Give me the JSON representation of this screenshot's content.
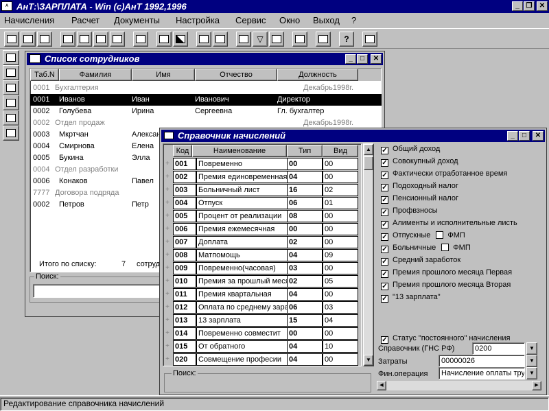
{
  "app_title": "АнТ:\\ЗАРПЛАТА - Win (c)АнТ 1992,1996",
  "menu": [
    "Начисления",
    "Расчет",
    "Документы",
    "Настройка",
    "Сервис",
    "Окно",
    "Выход",
    "?"
  ],
  "emp_window": {
    "title": "Список сотрудников",
    "columns": [
      "Таб.N",
      "Фамилия",
      "Имя",
      "Отчество",
      "Должность"
    ],
    "rows": [
      {
        "tab": "0001",
        "fam": "Бухгалтерия",
        "name": "",
        "otch": "",
        "dol": "Декабрь1998г.",
        "type": "group"
      },
      {
        "tab": "0001",
        "fam": "Иванов",
        "name": "Иван",
        "otch": "Иванович",
        "dol": "Директор",
        "type": "selected"
      },
      {
        "tab": "0002",
        "fam": "Голубева",
        "name": "Ирина",
        "otch": "Сергеевна",
        "dol": "Гл. бухгалтер",
        "type": "normal"
      },
      {
        "tab": "0002",
        "fam": "Отдел продаж",
        "name": "",
        "otch": "",
        "dol": "Декабрь1998г.",
        "type": "group"
      },
      {
        "tab": "0003",
        "fam": "Мкртчан",
        "name": "Алексан",
        "otch": "",
        "dol": "",
        "type": "normal"
      },
      {
        "tab": "0004",
        "fam": "Смирнова",
        "name": "Елена",
        "otch": "",
        "dol": "",
        "type": "normal"
      },
      {
        "tab": "0005",
        "fam": "Букина",
        "name": "Элла",
        "otch": "",
        "dol": "",
        "type": "normal"
      },
      {
        "tab": "0004",
        "fam": "Отдел разработки",
        "name": "",
        "otch": "",
        "dol": "",
        "type": "group"
      },
      {
        "tab": "0006",
        "fam": "Конаков",
        "name": "Павел",
        "otch": "",
        "dol": "",
        "type": "normal"
      },
      {
        "tab": "7777",
        "fam": "Договора подряда",
        "name": "",
        "otch": "",
        "dol": "",
        "type": "group"
      },
      {
        "tab": "0002",
        "fam": "Петров",
        "name": "Петр",
        "otch": "",
        "dol": "",
        "type": "normal"
      }
    ],
    "total_label": "Итого по списку:",
    "total_value": "7",
    "total_suffix": "сотруд",
    "search_label": "Поиск:"
  },
  "nach_window": {
    "title": "Справочник начислений",
    "columns": [
      "Код",
      "Наименование",
      "Тип",
      "Вид"
    ],
    "rows": [
      {
        "kod": "001",
        "name": "Повременно",
        "tip": "00",
        "vid": "00"
      },
      {
        "kod": "002",
        "name": "Премия единовременная",
        "tip": "04",
        "vid": "00"
      },
      {
        "kod": "003",
        "name": "Больничный лист",
        "tip": "16",
        "vid": "02"
      },
      {
        "kod": "004",
        "name": "Отпуск",
        "tip": "06",
        "vid": "01"
      },
      {
        "kod": "005",
        "name": "Процент от реализации",
        "tip": "08",
        "vid": "00"
      },
      {
        "kod": "006",
        "name": "Премия ежемесячная",
        "tip": "00",
        "vid": "00"
      },
      {
        "kod": "007",
        "name": "Доплата",
        "tip": "02",
        "vid": "00"
      },
      {
        "kod": "008",
        "name": "Матпомощь",
        "tip": "04",
        "vid": "09"
      },
      {
        "kod": "009",
        "name": "Повременно(часовая)",
        "tip": "03",
        "vid": "00"
      },
      {
        "kod": "010",
        "name": "Премия за прошлый меся",
        "tip": "02",
        "vid": "05"
      },
      {
        "kod": "011",
        "name": "Премия квартальная",
        "tip": "04",
        "vid": "00"
      },
      {
        "kod": "012",
        "name": "Оплата по среднему зараб",
        "tip": "06",
        "vid": "03"
      },
      {
        "kod": "013",
        "name": "13 зарплата",
        "tip": "15",
        "vid": "04"
      },
      {
        "kod": "014",
        "name": "Повременно совместит",
        "tip": "00",
        "vid": "00"
      },
      {
        "kod": "015",
        "name": "От обратного",
        "tip": "04",
        "vid": "10"
      },
      {
        "kod": "020",
        "name": "Совмещение професии",
        "tip": "04",
        "vid": "00"
      }
    ],
    "checkboxes": [
      "Общий доход",
      "Совокупный доход",
      "Фактически отработанное время",
      "Подоходный налог",
      "Пенсионный налог",
      "Профвзносы",
      "Алименты и исполнительные листь",
      "Отпускные",
      "Больничные",
      "Средний заработок",
      "Премия прошлого месяца Первая",
      "Премия прошлого месяца Вторая",
      "\"13 зарплата\""
    ],
    "fmp_label": "ФМП",
    "status_const": "Статус \"постоянного\" начисления",
    "sprav_label": "Справочник (ГНС РФ)",
    "sprav_value": "0200",
    "zatraty_label": "Затраты",
    "zatraty_value": "00000026",
    "finop_label": "Фин.операция",
    "finop_value": "Начисление оплаты труд",
    "search_label": "Поиск:"
  },
  "status_text": "Редактирование справочника начислений"
}
